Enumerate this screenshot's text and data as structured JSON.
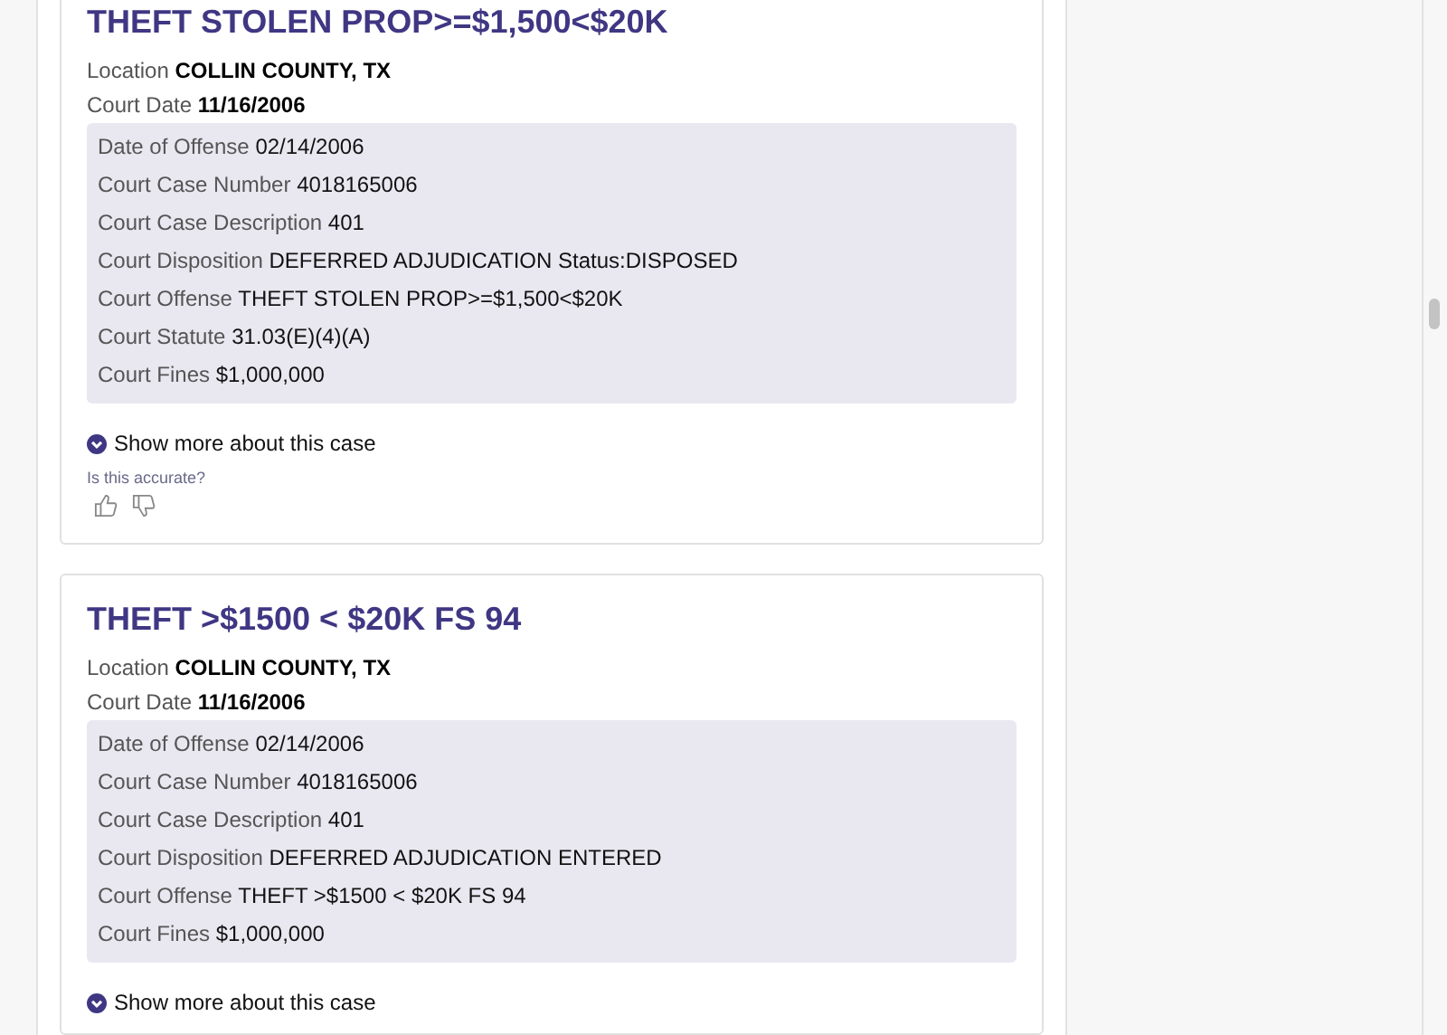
{
  "cases": [
    {
      "title": "THEFT STOLEN PROP>=$1,500<$20K",
      "summary": [
        {
          "label": "Location",
          "value": "COLLIN COUNTY, TX"
        },
        {
          "label": "Court Date",
          "value": "11/16/2006"
        }
      ],
      "details": [
        {
          "label": "Date of Offense",
          "value": "02/14/2006"
        },
        {
          "label": "Court Case Number",
          "value": "4018165006"
        },
        {
          "label": "Court Case Description",
          "value": "401"
        },
        {
          "label": "Court Disposition",
          "value": "DEFERRED ADJUDICATION Status:DISPOSED"
        },
        {
          "label": "Court Offense",
          "value": "THEFT STOLEN PROP>=$1,500<$20K"
        },
        {
          "label": "Court Statute",
          "value": "31.03(E)(4)(A)"
        },
        {
          "label": "Court Fines",
          "value": "$1,000,000"
        }
      ],
      "show_more": "Show more about this case",
      "feedback": {
        "question": "Is this accurate?"
      }
    },
    {
      "title": "THEFT >$1500 < $20K FS 94",
      "summary": [
        {
          "label": "Location",
          "value": "COLLIN COUNTY, TX"
        },
        {
          "label": "Court Date",
          "value": "11/16/2006"
        }
      ],
      "details": [
        {
          "label": "Date of Offense",
          "value": "02/14/2006"
        },
        {
          "label": "Court Case Number",
          "value": "4018165006"
        },
        {
          "label": "Court Case Description",
          "value": "401"
        },
        {
          "label": "Court Disposition",
          "value": "DEFERRED ADJUDICATION ENTERED"
        },
        {
          "label": "Court Offense",
          "value": "THEFT >$1500 < $20K FS 94"
        },
        {
          "label": "Court Fines",
          "value": "$1,000,000"
        }
      ],
      "show_more": "Show more about this case"
    }
  ]
}
